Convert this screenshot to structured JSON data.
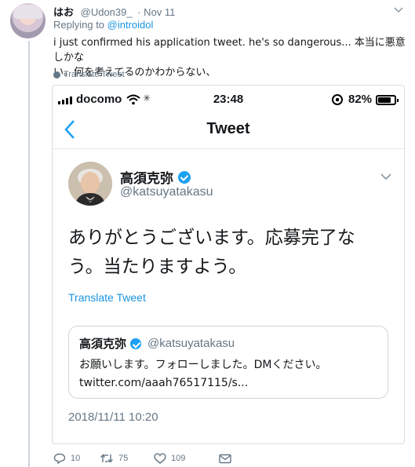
{
  "tweet": {
    "display_name": "はお",
    "handle": "@Udon39_",
    "time": "· Nov 11",
    "replying_prefix": "Replying to",
    "replying_to": "@introidol",
    "text_line1": "i just confirmed his application tweet. he's so dangerous... 本当に悪意しかな",
    "text_line2": "い。何を考えてるのかわからない、",
    "translate_label": "Translate Tweet"
  },
  "screenshot": {
    "status": {
      "carrier": "docomo",
      "time": "23:48",
      "battery": "82%",
      "battery_level": 0.82
    },
    "nav_title": "Tweet",
    "author_name": "高須克弥",
    "author_handle": "@katsuyatakasu",
    "tweet_line1": "ありがとうございます。応募完了な",
    "tweet_line2": "う。当たりますよう。",
    "translate_label": "Translate Tweet",
    "quoted": {
      "name": "高須克弥",
      "handle": "@katsuyatakasu",
      "line1": "お願いします。フォローしました。DMください。",
      "line2": "twitter.com/aaah76517115/s..."
    },
    "timestamp": "2018/11/11 10:20"
  },
  "actions": {
    "replies": "10",
    "retweets": "75",
    "likes": "109"
  },
  "colors": {
    "link": "#1b95e0",
    "verified": "#1da1f2",
    "muted": "#657786",
    "border": "#ccd6dd"
  }
}
